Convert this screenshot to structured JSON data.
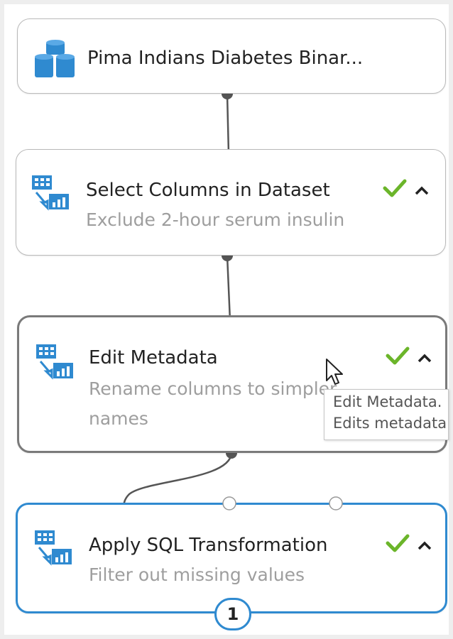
{
  "modules": [
    {
      "title": "Pima Indians Diabetes Binar...",
      "subtitle": ""
    },
    {
      "title": "Select Columns in Dataset",
      "subtitle": "Exclude 2-hour serum insulin"
    },
    {
      "title": "Edit Metadata",
      "subtitle": "Rename columns to simpler names"
    },
    {
      "title": "Apply SQL Transformation",
      "subtitle": "Filter out missing values"
    }
  ],
  "tooltip": {
    "line1": "Edit Metadata.",
    "line2": "Edits metadata"
  },
  "badge": "1",
  "icons": {
    "dataset": "database-stack-icon",
    "module": "table-transform-icon",
    "status": "checkmark-icon",
    "collapse": "chevron-up-icon",
    "cursor": "mouse-pointer-icon"
  },
  "colors": {
    "check": "#6bb52a",
    "icon_blue": "#2f8ad0",
    "selected_border": "#2f8ad0"
  }
}
